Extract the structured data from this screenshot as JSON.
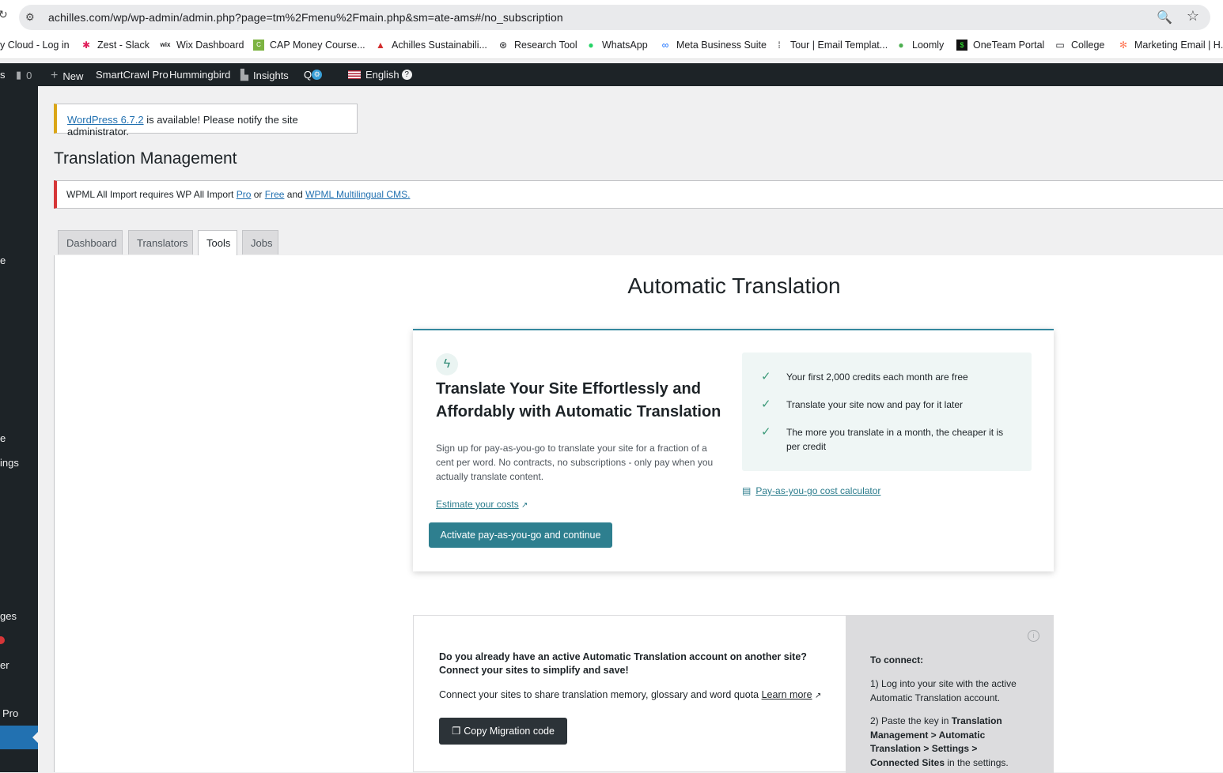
{
  "browser": {
    "url": "achilles.com/wp/wp-admin/admin.php?page=tm%2Fmenu%2Fmain.php&sm=ate-ams#/no_subscription",
    "bookmarks": [
      {
        "label": "y Cloud - Log in",
        "icon": ""
      },
      {
        "label": "Zest - Slack",
        "icon": "slack-icon"
      },
      {
        "label": "Wix Dashboard",
        "icon": "wix-icon"
      },
      {
        "label": "CAP Money Course...",
        "icon": "cap-icon"
      },
      {
        "label": "Achilles Sustainabili...",
        "icon": "achilles-icon"
      },
      {
        "label": "Research Tool",
        "icon": "openai-icon"
      },
      {
        "label": "WhatsApp",
        "icon": "whatsapp-icon"
      },
      {
        "label": "Meta Business Suite",
        "icon": "meta-icon"
      },
      {
        "label": "Tour | Email Templat...",
        "icon": "tour-icon"
      },
      {
        "label": "Loomly",
        "icon": "loomly-icon"
      },
      {
        "label": "OneTeam Portal",
        "icon": "oneteam-icon"
      },
      {
        "label": "College",
        "icon": "folder-icon"
      },
      {
        "label": "Marketing Email | H...",
        "icon": "hubspot-icon"
      }
    ]
  },
  "adminbar": {
    "comments_count": "0",
    "new_label": "New",
    "smartcrawl_label": "SmartCrawl Pro",
    "hummingbird_label": "Hummingbird",
    "insights_label": "Insights",
    "language_label": "English",
    "left_fragment": "s"
  },
  "sidebar": {
    "fragments": [
      "e",
      "e",
      "ings",
      "ges",
      "er",
      "Pro"
    ]
  },
  "notices": {
    "update_link": "WordPress 6.7.2",
    "update_text": " is available! Please notify the site administrator.",
    "error_prefix": "WPML All Import requires WP All Import ",
    "error_pro": "Pro",
    "error_or": " or ",
    "error_free": "Free",
    "error_and": " and ",
    "error_wpml": "WPML Multilingual CMS."
  },
  "page_title": "Translation Management",
  "tabs": [
    "Dashboard",
    "Translators",
    "Tools",
    "Jobs"
  ],
  "active_tab": "Tools",
  "auto_translation": {
    "title": "Automatic Translation",
    "heading": "Translate Your Site Effortlessly and Affordably with Automatic Translation",
    "description": "Sign up for pay-as-you-go to translate your site for a fraction of a cent per word. No contracts, no subscriptions - only pay when you actually translate content.",
    "estimate_link": "Estimate your costs",
    "activate_button": "Activate pay-as-you-go and continue",
    "benefits": [
      "Your first 2,000 credits each month are free",
      "Translate your site now and pay for it later",
      "The more you translate in a month, the cheaper it is per credit"
    ],
    "calculator_link": "Pay-as-you-go cost calculator"
  },
  "connect": {
    "heading": "Do you already have an active Automatic Translation account on another site? Connect your sites to simplify and save!",
    "description": "Connect your sites to share translation memory, glossary and word quota ",
    "learn_more": "Learn more",
    "copy_button": "Copy Migration code",
    "to_connect": "To connect:",
    "step1": "1) Log into your site with the active Automatic Translation account.",
    "step2_prefix": "2) Paste the key in ",
    "step2_bold": "Translation Management > Automatic Translation > Settings > Connected Sites",
    "step2_suffix": " in the settings."
  },
  "colors": {
    "accent": "#2e7f8f",
    "admin_bar": "#1d2327",
    "error_border": "#d63638",
    "update_border": "#dba617"
  }
}
